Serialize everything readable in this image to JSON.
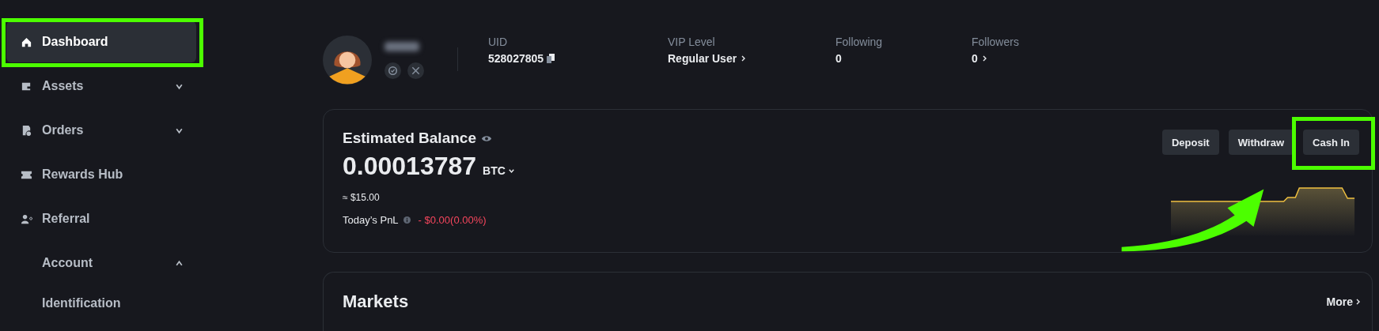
{
  "sidebar": {
    "items": [
      {
        "label": "Dashboard",
        "selected": true
      },
      {
        "label": "Assets",
        "selected": false,
        "expanded": false
      },
      {
        "label": "Orders",
        "selected": false,
        "expanded": false
      },
      {
        "label": "Rewards Hub",
        "selected": false
      },
      {
        "label": "Referral",
        "selected": false
      },
      {
        "label": "Account",
        "selected": false,
        "expanded": true,
        "children": [
          {
            "label": "Identification",
            "selected": false
          }
        ]
      }
    ]
  },
  "profile": {
    "stats": [
      {
        "label": "UID",
        "value": "528027805",
        "kind": "copy"
      },
      {
        "label": "VIP Level",
        "value": "Regular User",
        "kind": "link"
      },
      {
        "label": "Following",
        "value": "0",
        "kind": "plain"
      },
      {
        "label": "Followers",
        "value": "0",
        "kind": "link"
      }
    ]
  },
  "balance": {
    "title": "Estimated Balance",
    "amount": "0.00013787",
    "currency": "BTC",
    "fiat": "≈ $15.00",
    "pnl_label": "Today’s PnL",
    "pnl_value": "- $0.00(0.00%)",
    "buttons": [
      {
        "label": "Deposit",
        "highlighted": false
      },
      {
        "label": "Withdraw",
        "highlighted": false
      },
      {
        "label": "Cash In",
        "highlighted": true
      }
    ]
  },
  "markets": {
    "title": "Markets",
    "more": "More"
  }
}
